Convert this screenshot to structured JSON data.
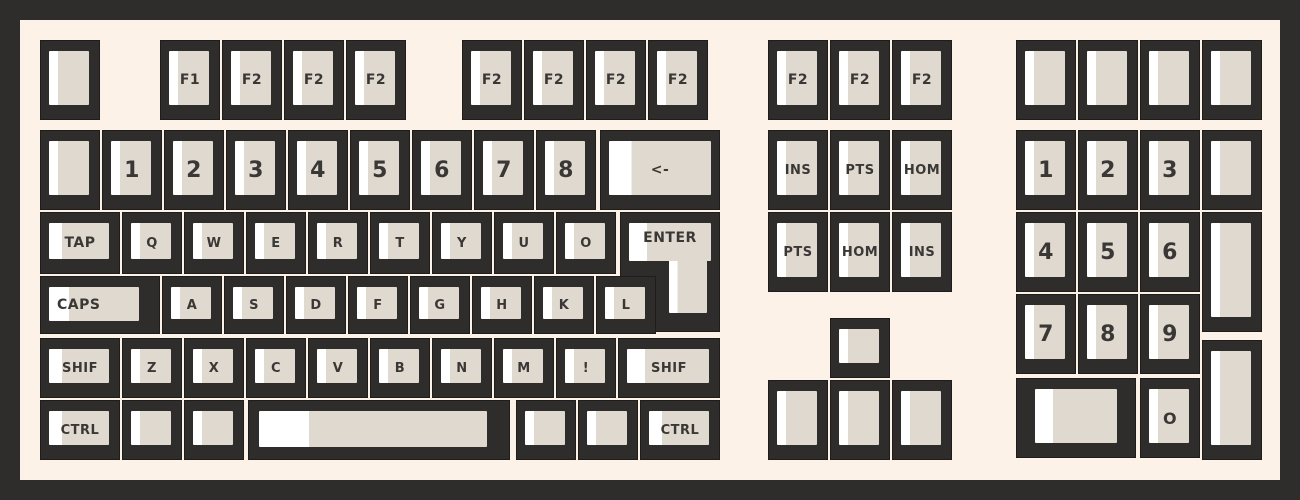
{
  "colors": {
    "frame": "#2f2d2c",
    "board": "#fdf2e7",
    "keycap": "#e0d9cf",
    "keycap_highlight": "#ffffff",
    "legend": "#3a3836"
  },
  "keys": [
    {
      "id": "esc",
      "label": ""
    },
    {
      "id": "f1",
      "label": "F1"
    },
    {
      "id": "f2",
      "label": "F2"
    },
    {
      "id": "f3",
      "label": "F2"
    },
    {
      "id": "f4",
      "label": "F2"
    },
    {
      "id": "f5",
      "label": "F2"
    },
    {
      "id": "f6",
      "label": "F2"
    },
    {
      "id": "f7",
      "label": "F2"
    },
    {
      "id": "f8",
      "label": "F2"
    },
    {
      "id": "f9",
      "label": "F2"
    },
    {
      "id": "f10",
      "label": "F2"
    },
    {
      "id": "f11",
      "label": "F2"
    },
    {
      "id": "np-top-1",
      "label": ""
    },
    {
      "id": "np-top-2",
      "label": ""
    },
    {
      "id": "np-top-3",
      "label": ""
    },
    {
      "id": "np-top-4",
      "label": ""
    },
    {
      "id": "backtick",
      "label": ""
    },
    {
      "id": "num-1",
      "label": "1"
    },
    {
      "id": "num-2",
      "label": "2"
    },
    {
      "id": "num-3",
      "label": "3"
    },
    {
      "id": "num-4",
      "label": "4"
    },
    {
      "id": "num-5",
      "label": "5"
    },
    {
      "id": "num-6",
      "label": "6"
    },
    {
      "id": "num-7",
      "label": "7"
    },
    {
      "id": "num-8",
      "label": "8"
    },
    {
      "id": "backspace",
      "label": "<-"
    },
    {
      "id": "ins-top",
      "label": "INS"
    },
    {
      "id": "pts-top",
      "label": "PTS"
    },
    {
      "id": "hom-top",
      "label": "HOM"
    },
    {
      "id": "np-1",
      "label": "1"
    },
    {
      "id": "np-2",
      "label": "2"
    },
    {
      "id": "np-3",
      "label": "3"
    },
    {
      "id": "np-minus",
      "label": ""
    },
    {
      "id": "tab",
      "label": "TAP"
    },
    {
      "id": "q",
      "label": "Q"
    },
    {
      "id": "w",
      "label": "W"
    },
    {
      "id": "e",
      "label": "E"
    },
    {
      "id": "r",
      "label": "R"
    },
    {
      "id": "t",
      "label": "T"
    },
    {
      "id": "y",
      "label": "Y"
    },
    {
      "id": "u",
      "label": "U"
    },
    {
      "id": "o",
      "label": "O"
    },
    {
      "id": "enter",
      "label": "ENTER"
    },
    {
      "id": "pts-bottom",
      "label": "PTS"
    },
    {
      "id": "hom-bottom",
      "label": "HOM"
    },
    {
      "id": "ins-bottom",
      "label": "INS"
    },
    {
      "id": "np-4",
      "label": "4"
    },
    {
      "id": "np-5",
      "label": "5"
    },
    {
      "id": "np-6",
      "label": "6"
    },
    {
      "id": "np-plus",
      "label": ""
    },
    {
      "id": "caps",
      "label": "CAPS"
    },
    {
      "id": "a",
      "label": "A"
    },
    {
      "id": "s",
      "label": "S"
    },
    {
      "id": "d",
      "label": "D"
    },
    {
      "id": "f",
      "label": "F"
    },
    {
      "id": "g",
      "label": "G"
    },
    {
      "id": "h",
      "label": "H"
    },
    {
      "id": "k",
      "label": "K"
    },
    {
      "id": "l",
      "label": "L"
    },
    {
      "id": "np-7",
      "label": "7"
    },
    {
      "id": "np-8",
      "label": "8"
    },
    {
      "id": "np-9",
      "label": "9"
    },
    {
      "id": "shift-left",
      "label": "SHIF"
    },
    {
      "id": "z",
      "label": "Z"
    },
    {
      "id": "x",
      "label": "X"
    },
    {
      "id": "c",
      "label": "C"
    },
    {
      "id": "v",
      "label": "V"
    },
    {
      "id": "b",
      "label": "B"
    },
    {
      "id": "n",
      "label": "N"
    },
    {
      "id": "m",
      "label": "M"
    },
    {
      "id": "excl",
      "label": "!"
    },
    {
      "id": "shift-right",
      "label": "SHIF"
    },
    {
      "id": "arrow-up",
      "label": ""
    },
    {
      "id": "np-enter",
      "label": ""
    },
    {
      "id": "ctrl-left",
      "label": "CTRL"
    },
    {
      "id": "meta-left",
      "label": ""
    },
    {
      "id": "alt-left",
      "label": ""
    },
    {
      "id": "space",
      "label": ""
    },
    {
      "id": "alt-right",
      "label": ""
    },
    {
      "id": "meta-right",
      "label": ""
    },
    {
      "id": "ctrl-right",
      "label": "CTRL"
    },
    {
      "id": "arrow-left",
      "label": ""
    },
    {
      "id": "arrow-down",
      "label": ""
    },
    {
      "id": "arrow-right",
      "label": ""
    },
    {
      "id": "np-0",
      "label": ""
    },
    {
      "id": "np-dot",
      "label": "O"
    }
  ]
}
